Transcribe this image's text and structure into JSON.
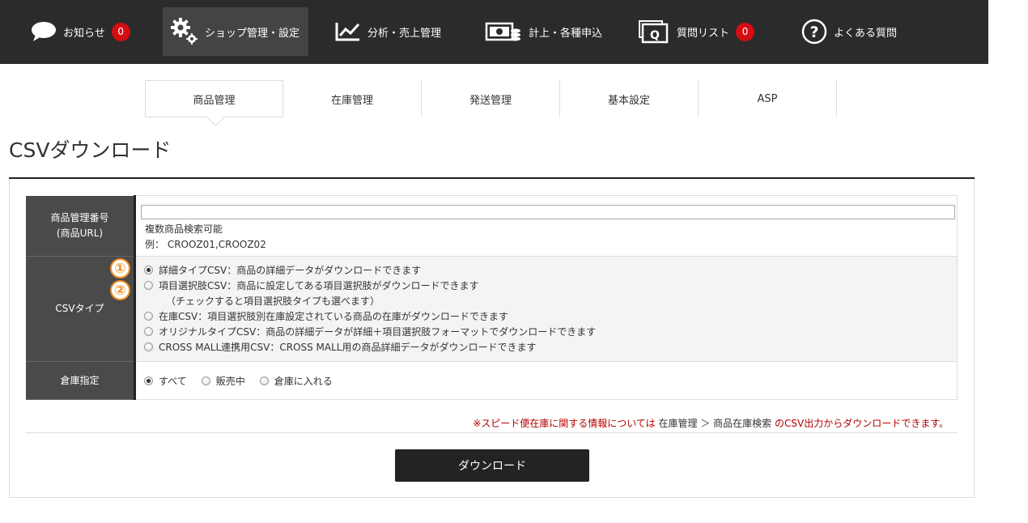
{
  "topnav": [
    {
      "label": "お知らせ",
      "icon": "speech-bubble-icon",
      "badge": "0"
    },
    {
      "label": "ショップ管理・設定",
      "icon": "gears-icon",
      "badge": null
    },
    {
      "label": "分析・売上管理",
      "icon": "line-chart-icon",
      "badge": null
    },
    {
      "label": "計上・各種申込",
      "icon": "money-icon",
      "badge": null
    },
    {
      "label": "質問リスト",
      "icon": "question-list-icon",
      "badge": "0"
    },
    {
      "label": "よくある質問",
      "icon": "help-circle-icon",
      "badge": null
    }
  ],
  "subnav": [
    "商品管理",
    "在庫管理",
    "発送管理",
    "基本設定",
    "ASP"
  ],
  "page_title": "CSVダウンロード",
  "form": {
    "product_no": {
      "label_line1": "商品管理番号",
      "label_line2": "(商品URL)",
      "value": "",
      "hint1": "複数商品検索可能",
      "hint2": "例： CROOZ01,CROOZ02"
    },
    "csv_type": {
      "label": "CSVタイプ",
      "options": [
        "詳細タイプCSV：商品の詳細データがダウンロードできます",
        "項目選択肢CSV：商品に設定してある項目選択肢がダウンロードできます",
        "在庫CSV：項目選択肢別在庫設定されている商品の在庫がダウンロードできます",
        "オリジナルタイプCSV：商品の詳細データが詳細＋項目選択肢フォーマットでダウンロードできます",
        "CROSS MALL連携用CSV：CROSS MALL用の商品詳細データがダウンロードできます"
      ],
      "option2_note": "（チェックすると項目選択肢タイプも選べます）",
      "selected_index": 0,
      "markers": [
        "①",
        "②"
      ]
    },
    "warehouse": {
      "label": "倉庫指定",
      "options": [
        "すべて",
        "販売中",
        "倉庫に入れる"
      ],
      "selected_index": 0
    }
  },
  "notice": {
    "part1": "※スピード便在庫に関する情報については",
    "link": "在庫管理 ＞ 商品在庫検索",
    "part2": "のCSV出力からダウンロードできます。"
  },
  "download_label": "ダウンロード",
  "colors": {
    "topbar": "#2b2b2b",
    "badge": "#d40d12",
    "marker": "#f08c1e",
    "notice": "#b50000",
    "button": "#232323"
  }
}
